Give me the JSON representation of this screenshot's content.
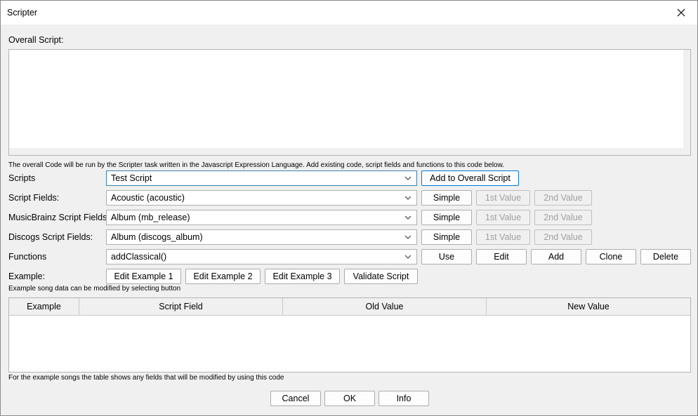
{
  "window": {
    "title": "Scripter"
  },
  "overall": {
    "label": "Overall Script:",
    "note": "The overall Code will be run by the Scripter task written in the Javascript Expression Language. Add existing code, script fields and functions to this code below."
  },
  "rows": {
    "scripts": {
      "label": "Scripts",
      "value": "Test Script",
      "button": "Add to Overall Script"
    },
    "script_fields": {
      "label": "Script Fields:",
      "value": "Acoustic (acoustic)",
      "simple": "Simple",
      "first": "1st Value",
      "second": "2nd Value"
    },
    "mb_fields": {
      "label": "MusicBrainz Script Fields:",
      "value": "Album (mb_release)",
      "simple": "Simple",
      "first": "1st Value",
      "second": "2nd Value"
    },
    "discogs_fields": {
      "label": "Discogs Script Fields:",
      "value": "Album (discogs_album)",
      "simple": "Simple",
      "first": "1st Value",
      "second": "2nd Value"
    },
    "functions": {
      "label": "Functions",
      "value": "addClassical()",
      "use": "Use",
      "edit": "Edit",
      "add": "Add",
      "clone": "Clone",
      "delete": "Delete"
    }
  },
  "example": {
    "label": "Example:",
    "buttons": [
      "Edit Example 1",
      "Edit Example 2",
      "Edit Example 3",
      "Validate Script"
    ],
    "note": "Example song data can be modified by selecting button"
  },
  "table": {
    "columns": [
      "Example",
      "Script Field",
      "Old Value",
      "New Value"
    ],
    "note": "For the example songs the table shows any fields that will be modified by using this code"
  },
  "footer": {
    "cancel": "Cancel",
    "ok": "OK",
    "info": "Info"
  }
}
